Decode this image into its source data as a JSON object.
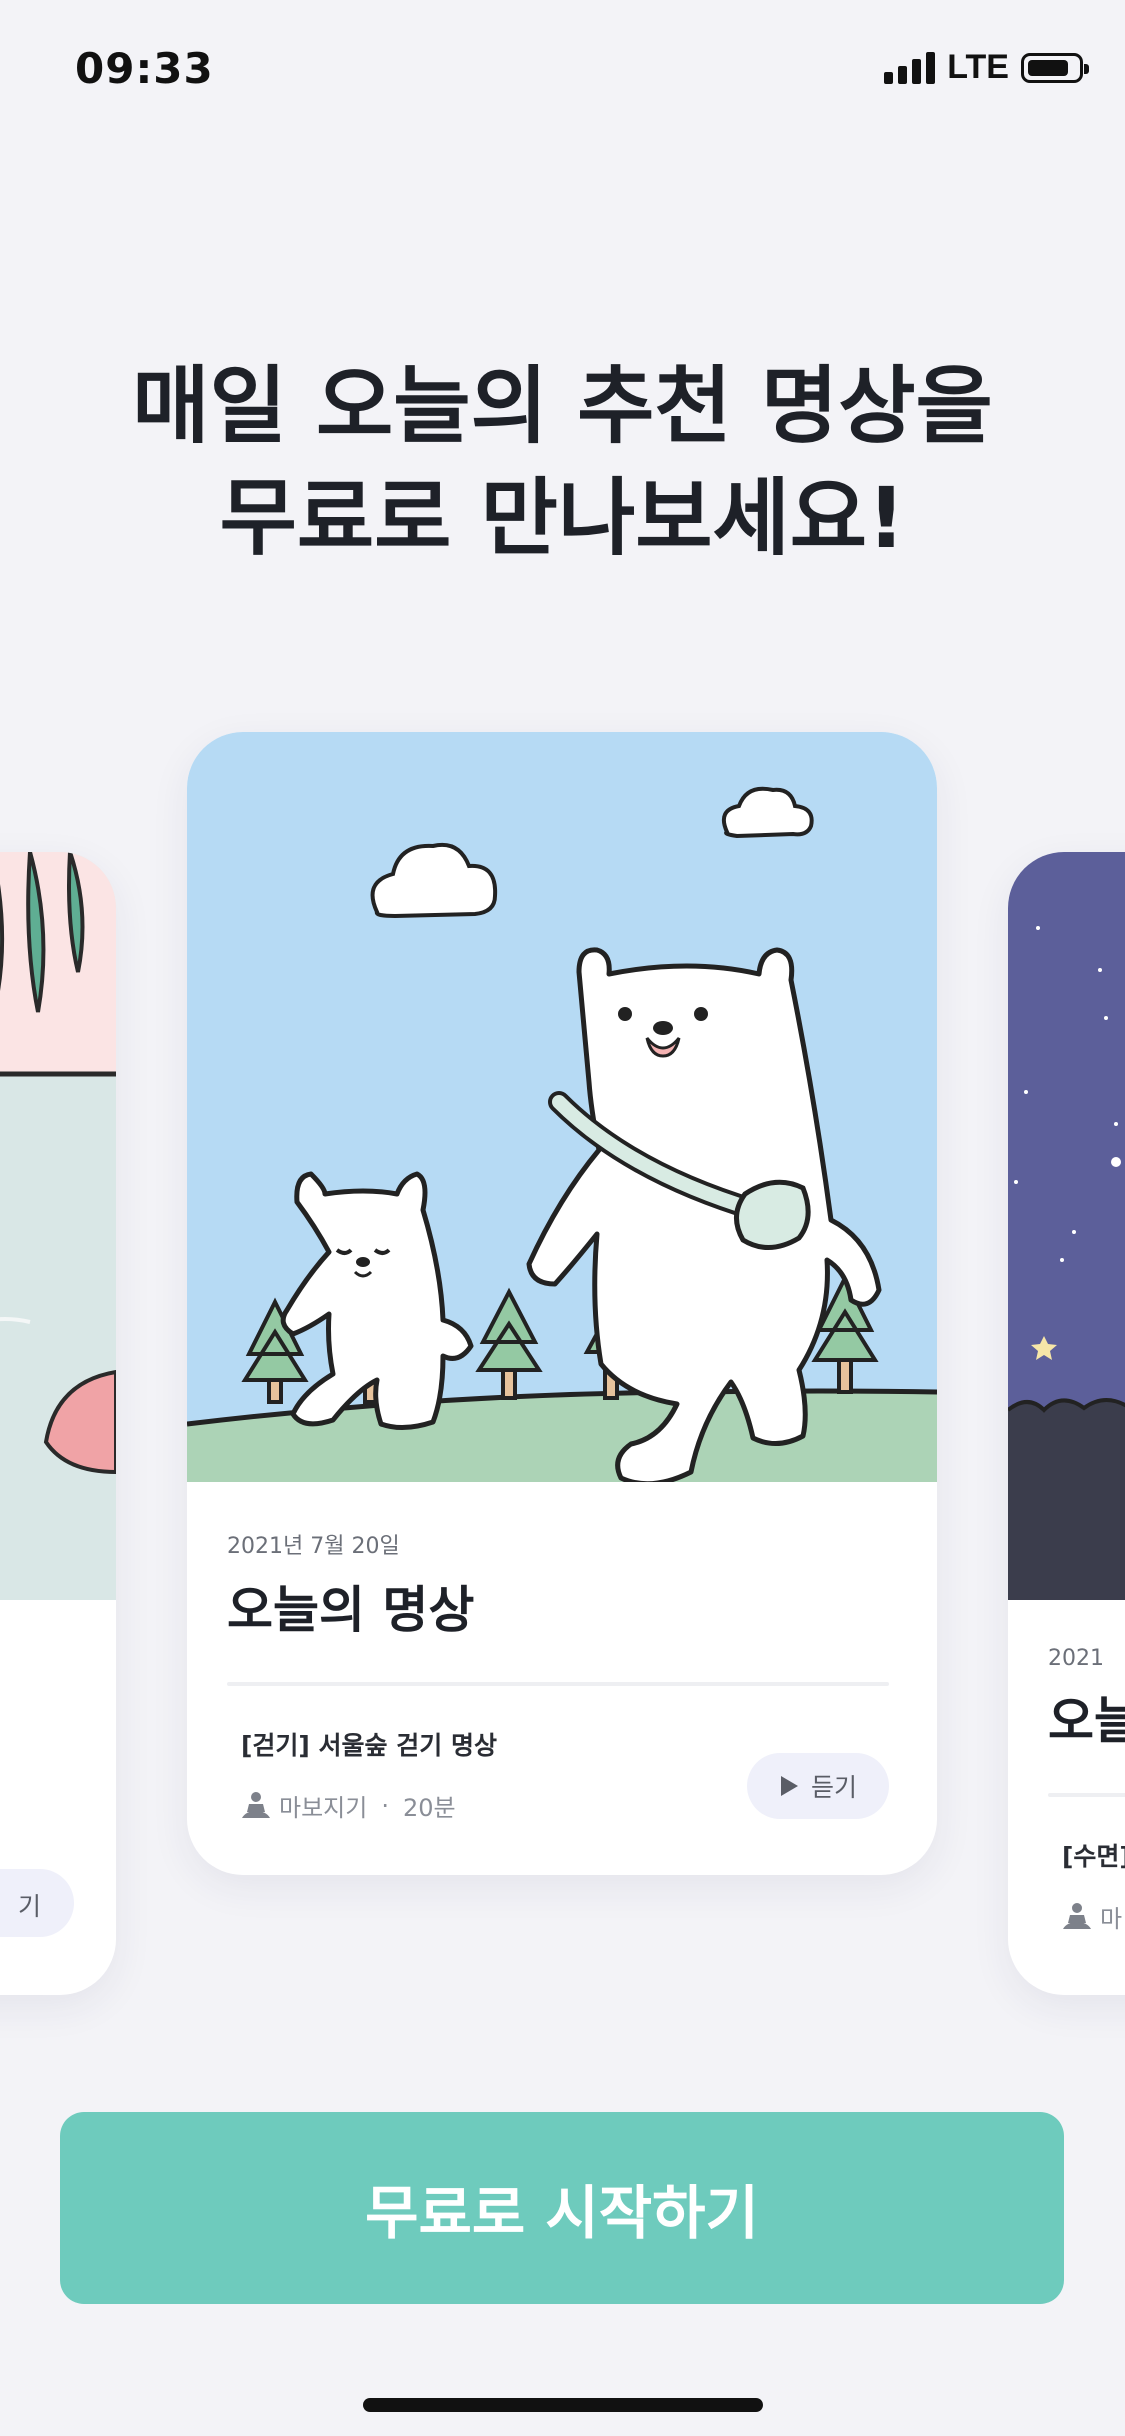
{
  "status_bar": {
    "time": "09:33",
    "network": "LTE"
  },
  "headline": {
    "line1": "매일 오늘의 추천 명상을",
    "line2": "무료로 만나보세요!"
  },
  "cards": {
    "center": {
      "date": "2021년 7월 20일",
      "title": "오늘의 명상",
      "track_title": "[걷기] 서울숲 걷기 명상",
      "author": "마보지기",
      "separator": "·",
      "duration": "20분",
      "play_label": "듣기",
      "illustration": "two-polar-bears-walking"
    },
    "left": {
      "play_label_partial": "기",
      "illustration": "lake-with-leaves"
    },
    "right": {
      "date_partial": "2021",
      "title_partial": "오늘",
      "track_partial": "[수면]",
      "author_partial": "마",
      "illustration": "night-sky"
    }
  },
  "cta": {
    "label": "무료로 시작하기"
  },
  "colors": {
    "background": "#f3f3f7",
    "accent": "#6ecbbd",
    "sky": "#b6daf4",
    "grass": "#acd3b6",
    "night": "#5c5f9a",
    "play_button_bg": "#eff0fa"
  }
}
